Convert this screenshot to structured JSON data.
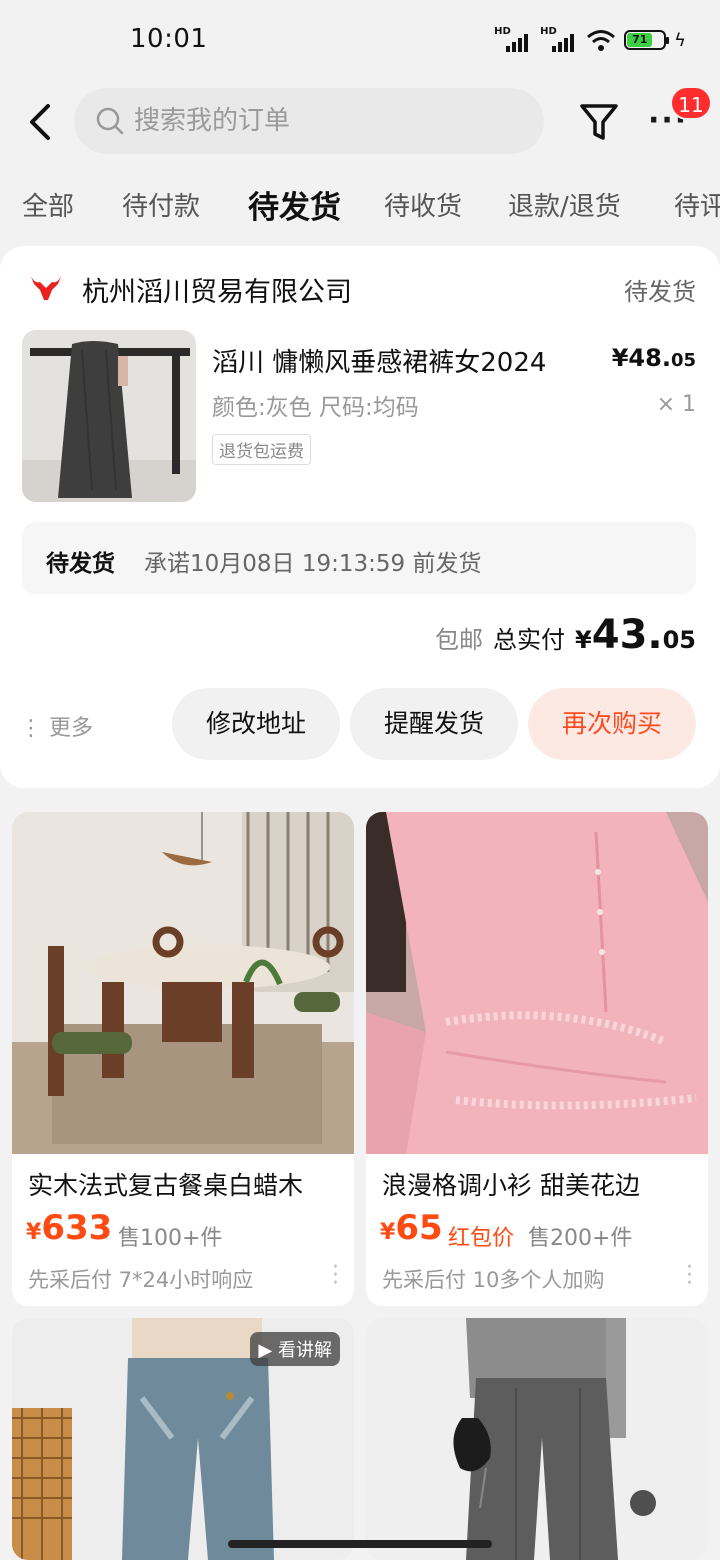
{
  "status_bar": {
    "time": "10:01",
    "battery": "71",
    "signal_1": "HD",
    "signal_2": "HD"
  },
  "header": {
    "search_placeholder": "搜索我的订单",
    "badge_count": "11"
  },
  "tabs": [
    {
      "label": "全部"
    },
    {
      "label": "待付款"
    },
    {
      "label": "待发货",
      "active": true
    },
    {
      "label": "待收货"
    },
    {
      "label": "退款/退货"
    },
    {
      "label": "待评"
    }
  ],
  "order": {
    "shop_name": "杭州滔川贸易有限公司",
    "status": "待发货",
    "product_title": "滔川  慵懒风垂感裙裤女2024",
    "price_main": "¥48.",
    "price_decimal": "05",
    "spec": "颜色:灰色 尺码:均码",
    "qty": "× 1",
    "tag": "退货包运费",
    "shipping_label": "待发货",
    "shipping_text": "承诺10月08日 19:13:59 前发货",
    "free_shipping": "包邮",
    "total_label": "总实付",
    "total_currency": "¥",
    "total_int": "43.",
    "total_dec": "05",
    "more": "更多",
    "btn_modify_address": "修改地址",
    "btn_remind_ship": "提醒发货",
    "btn_buy_again": "再次购买"
  },
  "feed": [
    {
      "title": "实木法式复古餐桌白蜡木",
      "currency": "¥",
      "price": "633",
      "red_label": "",
      "sold": "售100+件",
      "foot": "先采后付  7*24小时响应"
    },
    {
      "title": "浪漫格调小衫 甜美花边",
      "currency": "¥",
      "price": "65",
      "red_label": "红包价",
      "sold": "售200+件",
      "foot": "先采后付  10多个人加购"
    },
    {
      "video_tag": "看讲解"
    },
    {}
  ],
  "colors": {
    "accent": "#ff4a12",
    "buy_again_bg": "#fde9e3",
    "badge": "#ff2d2d"
  }
}
